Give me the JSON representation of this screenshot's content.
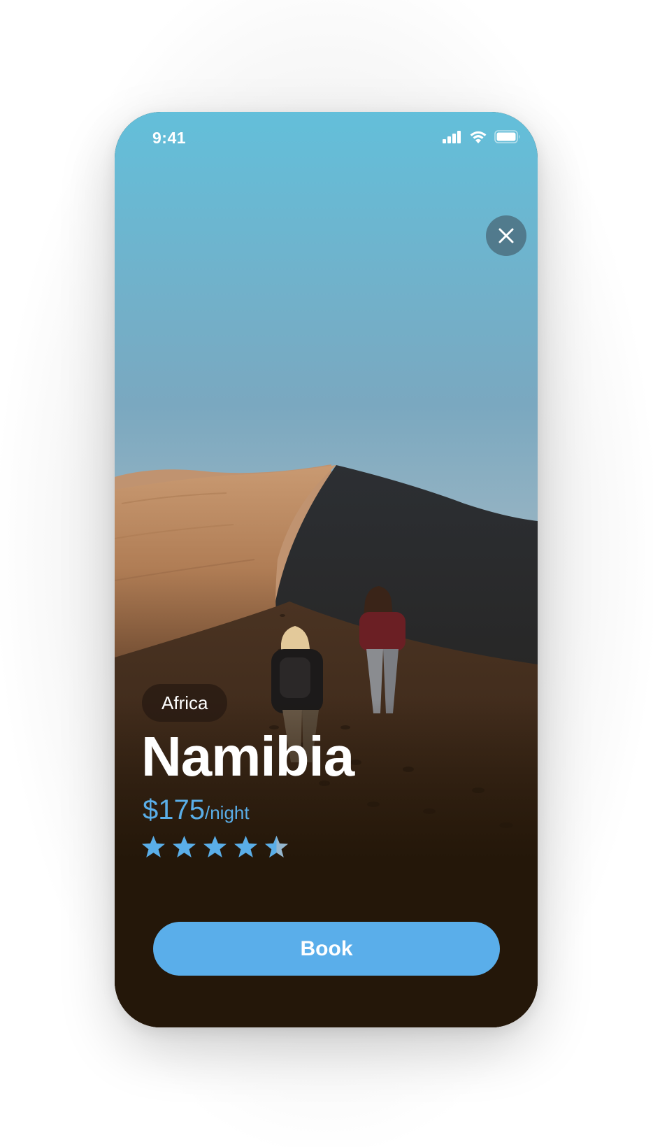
{
  "status_bar": {
    "time": "9:41"
  },
  "hero": {
    "image": "desert-dune-hikers-photo"
  },
  "close_icon": "close-icon",
  "destination": {
    "region_tag": "Africa",
    "name": "Namibia",
    "price_amount": "$175",
    "price_unit": "/night",
    "rating": 4.5,
    "rating_max": 5
  },
  "actions": {
    "book_label": "Book"
  },
  "colors": {
    "accent": "#5aaee8",
    "bottom_panel": "#241709",
    "sky_top": "#63bfda"
  }
}
